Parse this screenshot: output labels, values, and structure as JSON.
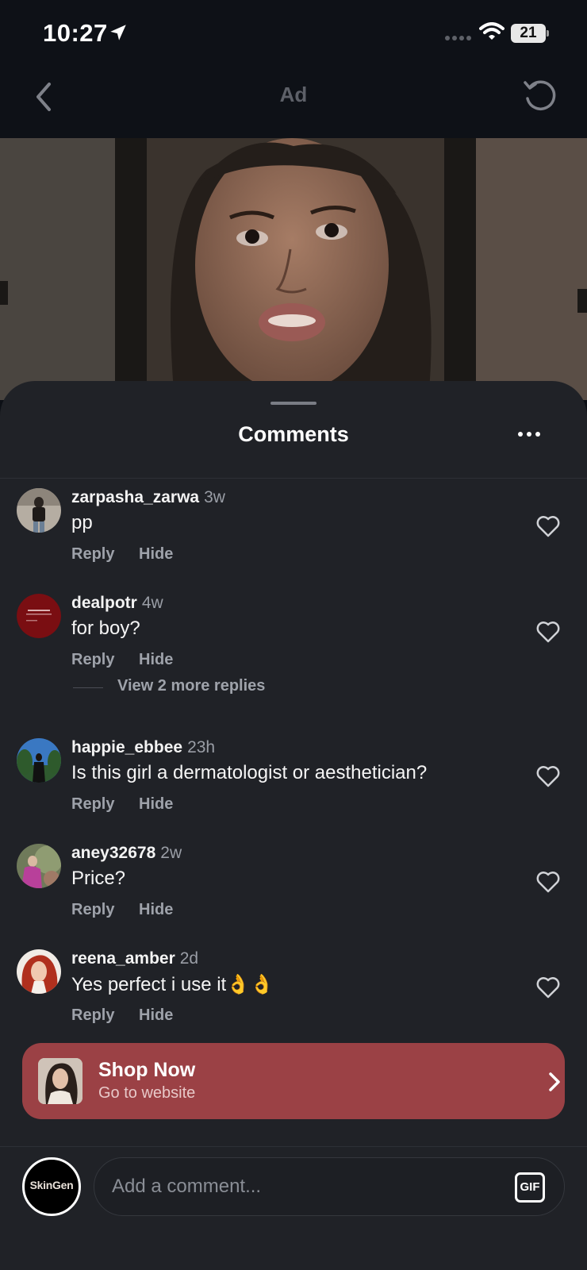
{
  "status_bar": {
    "time": "10:27",
    "battery": "21"
  },
  "nav": {
    "title": "Ad"
  },
  "sheet": {
    "title": "Comments"
  },
  "comments": [
    {
      "user": "zarpasha_zarwa",
      "time": "3w",
      "text": "pp",
      "reply": "Reply",
      "hide": "Hide"
    },
    {
      "user": "dealpotr",
      "time": "4w",
      "text": "for boy?",
      "reply": "Reply",
      "hide": "Hide"
    },
    {
      "user": "happie_ebbee",
      "time": "23h",
      "text": "Is this girl a dermatologist or aesthetician?",
      "reply": "Reply",
      "hide": "Hide"
    },
    {
      "user": "aney32678",
      "time": "2w",
      "text": "Price?",
      "reply": "Reply",
      "hide": "Hide"
    },
    {
      "user": "reena_amber",
      "time": "2d",
      "text": "Yes perfect i use it👌👌",
      "reply": "Reply",
      "hide": "Hide"
    }
  ],
  "view_replies": "View 2 more replies",
  "shop": {
    "title": "Shop Now",
    "subtitle": "Go to website"
  },
  "composer": {
    "avatar_text": "SkinGen",
    "placeholder": "Add a comment...",
    "gif": "GIF"
  },
  "colors": {
    "sheet_bg": "#202227",
    "shop_button": "#9b4145",
    "secondary_text": "#9ea2aa"
  },
  "icons": [
    "location-arrow-icon",
    "signal-icon",
    "wifi-icon",
    "back-icon",
    "refresh-icon",
    "more-icon",
    "heart-icon",
    "chevron-right-icon",
    "gif-icon"
  ]
}
